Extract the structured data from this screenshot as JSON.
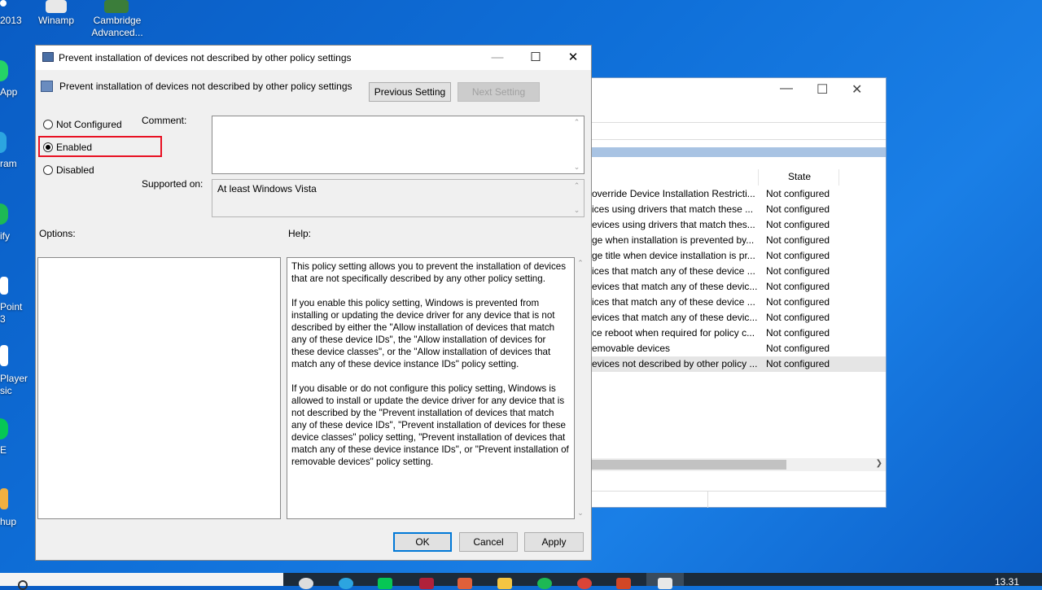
{
  "desktop": {
    "icons": [
      {
        "label": "2013"
      },
      {
        "label": "Winamp"
      },
      {
        "label": "Cambridge Advanced..."
      },
      {
        "label": "App"
      },
      {
        "label": "ram"
      },
      {
        "label": "ify"
      },
      {
        "label": "Point\n3"
      },
      {
        "label": "Player\nsic"
      },
      {
        "label": "E"
      },
      {
        "label": "hup"
      }
    ]
  },
  "background_window": {
    "column_state": "State",
    "rows": [
      {
        "name": "override Device Installation Restricti...",
        "state": "Not configured"
      },
      {
        "name": "ices using drivers that match these ...",
        "state": "Not configured"
      },
      {
        "name": "evices using drivers that match thes...",
        "state": "Not configured"
      },
      {
        "name": "ge when installation is prevented by...",
        "state": "Not configured"
      },
      {
        "name": "ge title when device installation is pr...",
        "state": "Not configured"
      },
      {
        "name": "ices that match any of these device ...",
        "state": "Not configured"
      },
      {
        "name": "evices that match any of these devic...",
        "state": "Not configured"
      },
      {
        "name": "ices that match any of these device ...",
        "state": "Not configured"
      },
      {
        "name": "evices that match any of these devic...",
        "state": "Not configured"
      },
      {
        "name": "ce reboot when required for policy c...",
        "state": "Not configured"
      },
      {
        "name": "emovable devices",
        "state": "Not configured"
      },
      {
        "name": "evices not described by other policy ...",
        "state": "Not configured"
      }
    ]
  },
  "dialog": {
    "window_title": "Prevent installation of devices not described by other policy settings",
    "header_title": "Prevent installation of devices not described by other policy settings",
    "previous_setting": "Previous Setting",
    "next_setting": "Next Setting",
    "radio_not_configured": "Not Configured",
    "radio_enabled": "Enabled",
    "radio_disabled": "Disabled",
    "selected": "Enabled",
    "comment_label": "Comment:",
    "comment_value": "",
    "supported_on_label": "Supported on:",
    "supported_on_value": "At least Windows Vista",
    "options_label": "Options:",
    "help_label": "Help:",
    "help_paragraphs": [
      "This policy setting allows you to prevent the installation of devices that are not specifically described by any other policy setting.",
      "If you enable this policy setting, Windows is prevented from installing or updating the device driver for any device that is not described by either the \"Allow installation of devices that match any of these device IDs\", the \"Allow installation of devices for these device classes\", or the \"Allow installation of devices that match any of these device instance IDs\" policy setting.",
      "If you disable or do not configure this policy setting, Windows is allowed to install or update the device driver for any device that is not described by the \"Prevent installation of devices that match any of these device IDs\", \"Prevent installation of devices for these device classes\" policy setting, \"Prevent installation of devices that match any of these device instance IDs\", or \"Prevent installation of removable devices\" policy setting."
    ],
    "ok": "OK",
    "cancel": "Cancel",
    "apply": "Apply",
    "highlight_color": "#e81123"
  },
  "taskbar": {
    "clock": "13.31"
  }
}
